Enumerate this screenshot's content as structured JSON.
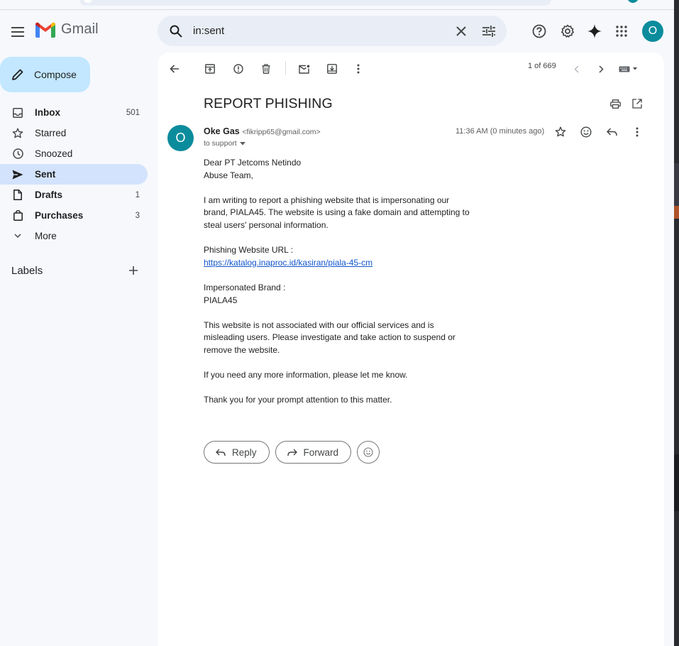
{
  "app": {
    "name": "Gmail"
  },
  "search": {
    "query": "in:sent"
  },
  "account": {
    "initial": "O"
  },
  "compose": {
    "label": "Compose"
  },
  "nav": [
    {
      "label": "Inbox",
      "count": "501",
      "bold": true,
      "icon": "inbox-icon"
    },
    {
      "label": "Starred",
      "count": "",
      "bold": false,
      "icon": "star-icon"
    },
    {
      "label": "Snoozed",
      "count": "",
      "bold": false,
      "icon": "clock-icon"
    },
    {
      "label": "Sent",
      "count": "",
      "bold": false,
      "active": true,
      "icon": "send-icon"
    },
    {
      "label": "Drafts",
      "count": "1",
      "bold": true,
      "icon": "draft-icon"
    },
    {
      "label": "Purchases",
      "count": "3",
      "bold": true,
      "icon": "shopping-bag-icon"
    },
    {
      "label": "More",
      "count": "",
      "bold": false,
      "icon": "chevron-down-icon"
    }
  ],
  "labels": {
    "title": "Labels"
  },
  "toolbar": {
    "pager": "1 of 669"
  },
  "email": {
    "subject": "REPORT PHISHING",
    "sender_initial": "O",
    "sender_name": "Oke Gas",
    "sender_email": "<fikripp65@gmail.com>",
    "to": "to support",
    "timestamp": "11:36 AM (0 minutes ago)",
    "body": {
      "greeting_1": "Dear PT Jetcoms Netindo",
      "greeting_2": "Abuse Team,",
      "p1_1": "I am writing to report a phishing website that is impersonating our",
      "p1_2": "brand, PIALA45. The website is using a fake domain and attempting to",
      "p1_3": "steal users' personal information.",
      "url_label": "Phishing Website URL :",
      "url": "https://katalog.inaproc.id/kasiran/piala-45-cm",
      "brand_label": "Impersonated Brand :",
      "brand": "PIALA45",
      "p3_1": "This website is not associated with our official services and is",
      "p3_2": "misleading users. Please investigate and take action to suspend or",
      "p3_3": "remove the website.",
      "p4": "If you need any more information, please let me know.",
      "p5": "Thank you for your prompt attention to this matter."
    }
  },
  "actions": {
    "reply": "Reply",
    "forward": "Forward"
  },
  "colors": {
    "accent": "#0b8c9c",
    "compose_bg": "#c2e7ff",
    "active_nav": "#d3e3fd",
    "link": "#1155cc"
  }
}
